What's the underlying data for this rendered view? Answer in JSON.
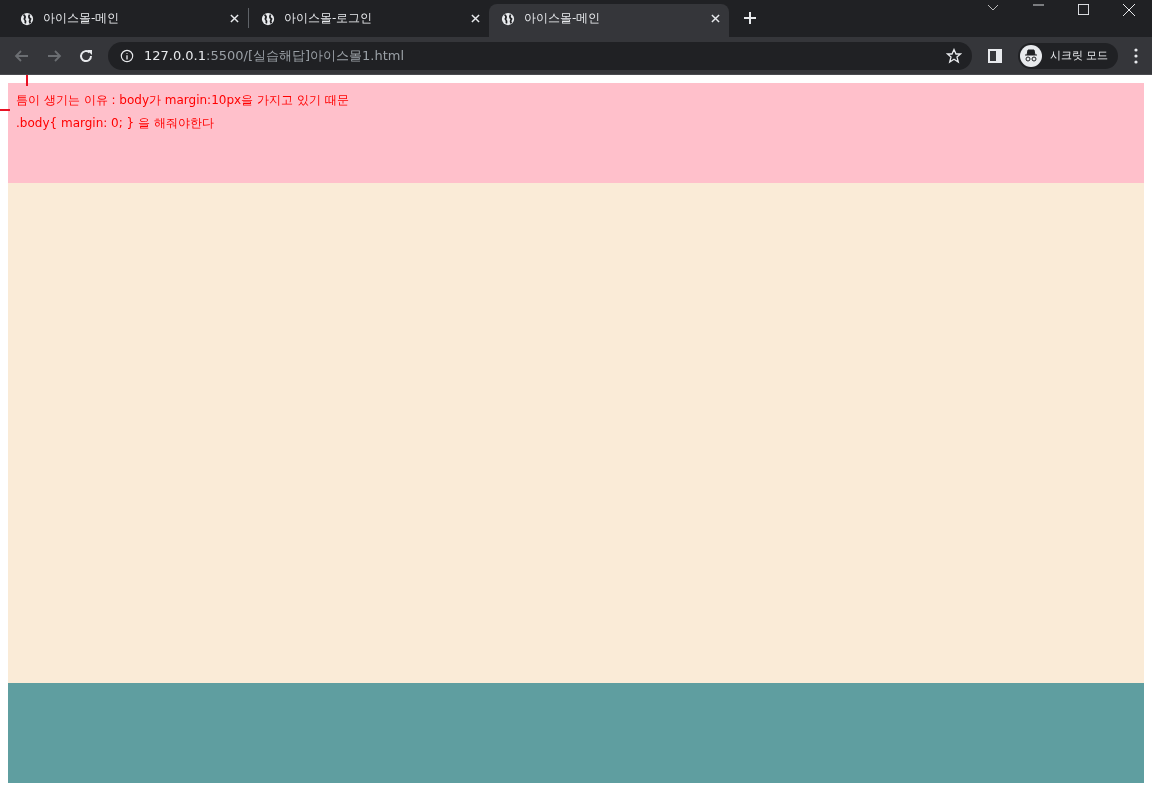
{
  "tabs": [
    {
      "title": "아이스몰-메인",
      "selected": false
    },
    {
      "title": "아이스몰-로그인",
      "selected": false
    },
    {
      "title": "아이스몰-메인",
      "selected": true
    }
  ],
  "address_bar": {
    "host": "127.0.0.1",
    "path": ":5500/[실습해답]아이스몰1.html"
  },
  "profile": {
    "label": "시크릿 모드"
  },
  "page": {
    "header_lines": [
      ".body{ margin: 0; } 을 해줘야한다"
    ],
    "header_title": "틈이 생기는 이유 : body가 margin:10px을 가지고 있기 때문"
  }
}
